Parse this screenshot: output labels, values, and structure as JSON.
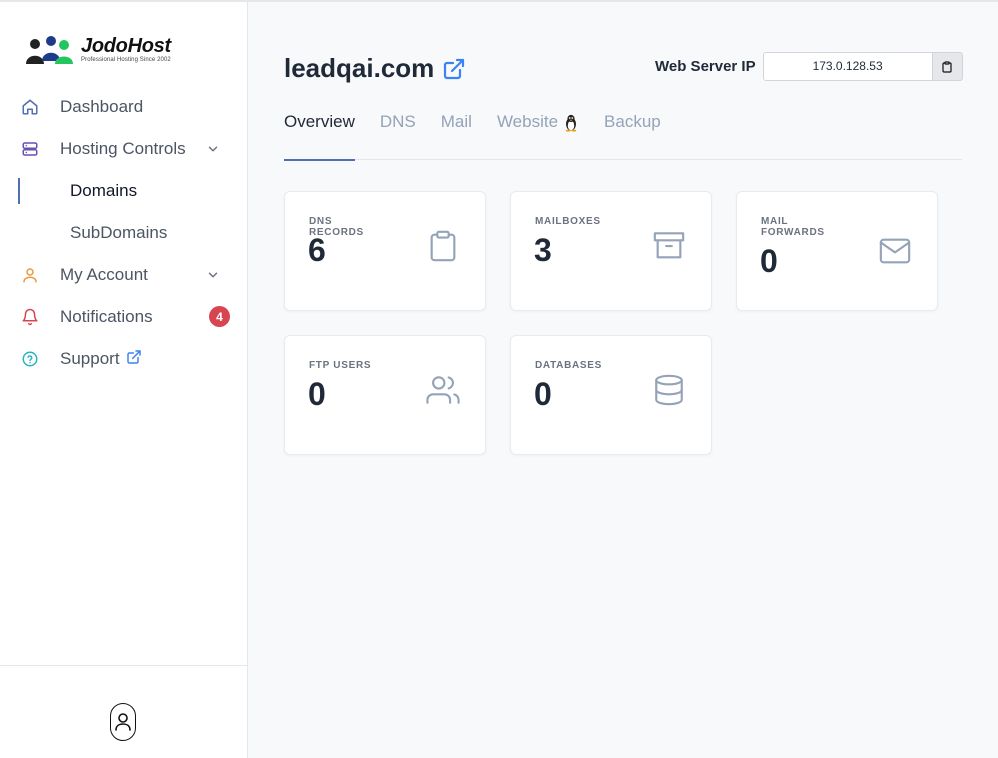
{
  "brand": {
    "name": "JodoHost",
    "tagline": "Professional Hosting Since 2002"
  },
  "sidebar": {
    "items": [
      {
        "label": "Dashboard",
        "icon": "home-icon"
      },
      {
        "label": "Hosting Controls",
        "icon": "server-icon",
        "expanded": true,
        "children": [
          {
            "label": "Domains",
            "active": true
          },
          {
            "label": "SubDomains"
          }
        ]
      },
      {
        "label": "My Account",
        "icon": "user-icon"
      },
      {
        "label": "Notifications",
        "icon": "bell-icon",
        "badge": "4"
      },
      {
        "label": "Support",
        "icon": "help-circle-icon"
      }
    ],
    "footer_icon": "user-profile-icon"
  },
  "header": {
    "domain": "leadqai.com",
    "ip_label": "Web Server IP",
    "ip_value": "173.0.128.53"
  },
  "tabs": [
    {
      "label": "Overview",
      "active": true
    },
    {
      "label": "DNS"
    },
    {
      "label": "Mail"
    },
    {
      "label": "Website",
      "icon": "linux-penguin-icon"
    },
    {
      "label": "Backup"
    }
  ],
  "stats": [
    {
      "label": "DNS RECORDS",
      "value": "6",
      "icon": "clipboard-icon"
    },
    {
      "label": "MAILBOXES",
      "value": "3",
      "icon": "archive-icon"
    },
    {
      "label": "MAIL FORWARDS",
      "value": "0",
      "icon": "envelope-icon"
    },
    {
      "label": "FTP USERS",
      "value": "0",
      "icon": "users-icon"
    },
    {
      "label": "DATABASES",
      "value": "0",
      "icon": "database-icon"
    }
  ],
  "colors": {
    "accent": "#4f6fb5",
    "link": "#3b82f6",
    "badge": "#d64550",
    "icon_muted": "#94a3b8"
  }
}
